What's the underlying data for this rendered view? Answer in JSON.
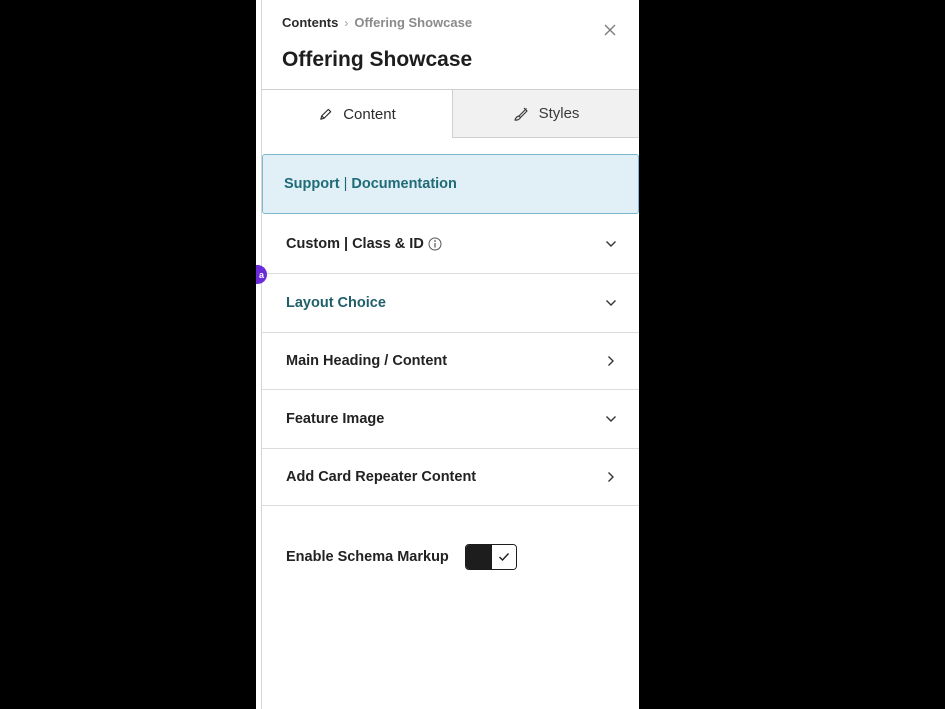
{
  "breadcrumb": {
    "root": "Contents",
    "separator": "›",
    "current": "Offering Showcase"
  },
  "page_title": "Offering Showcase",
  "tabs": [
    {
      "label": "Content",
      "icon": "pencil-icon",
      "active": true
    },
    {
      "label": "Styles",
      "icon": "brush-icon",
      "active": false
    }
  ],
  "support": {
    "support_label": "Support",
    "separator": "|",
    "documentation_label": "Documentation"
  },
  "badge": {
    "text": "a"
  },
  "sections": [
    {
      "label": "Custom | Class & ID",
      "has_info_icon": true,
      "chevron": "down"
    },
    {
      "label": "Layout Choice",
      "chevron": "down",
      "highlighted": true
    },
    {
      "label": "Main Heading / Content",
      "chevron": "right"
    },
    {
      "label": "Feature Image",
      "chevron": "down"
    },
    {
      "label": "Add Card Repeater Content",
      "chevron": "right"
    }
  ],
  "schema": {
    "label": "Enable Schema Markup",
    "enabled": true
  },
  "colors": {
    "accent_teal": "#1f6b78",
    "support_bg": "#e1f0f7",
    "badge_purple": "#6c2bd9"
  }
}
